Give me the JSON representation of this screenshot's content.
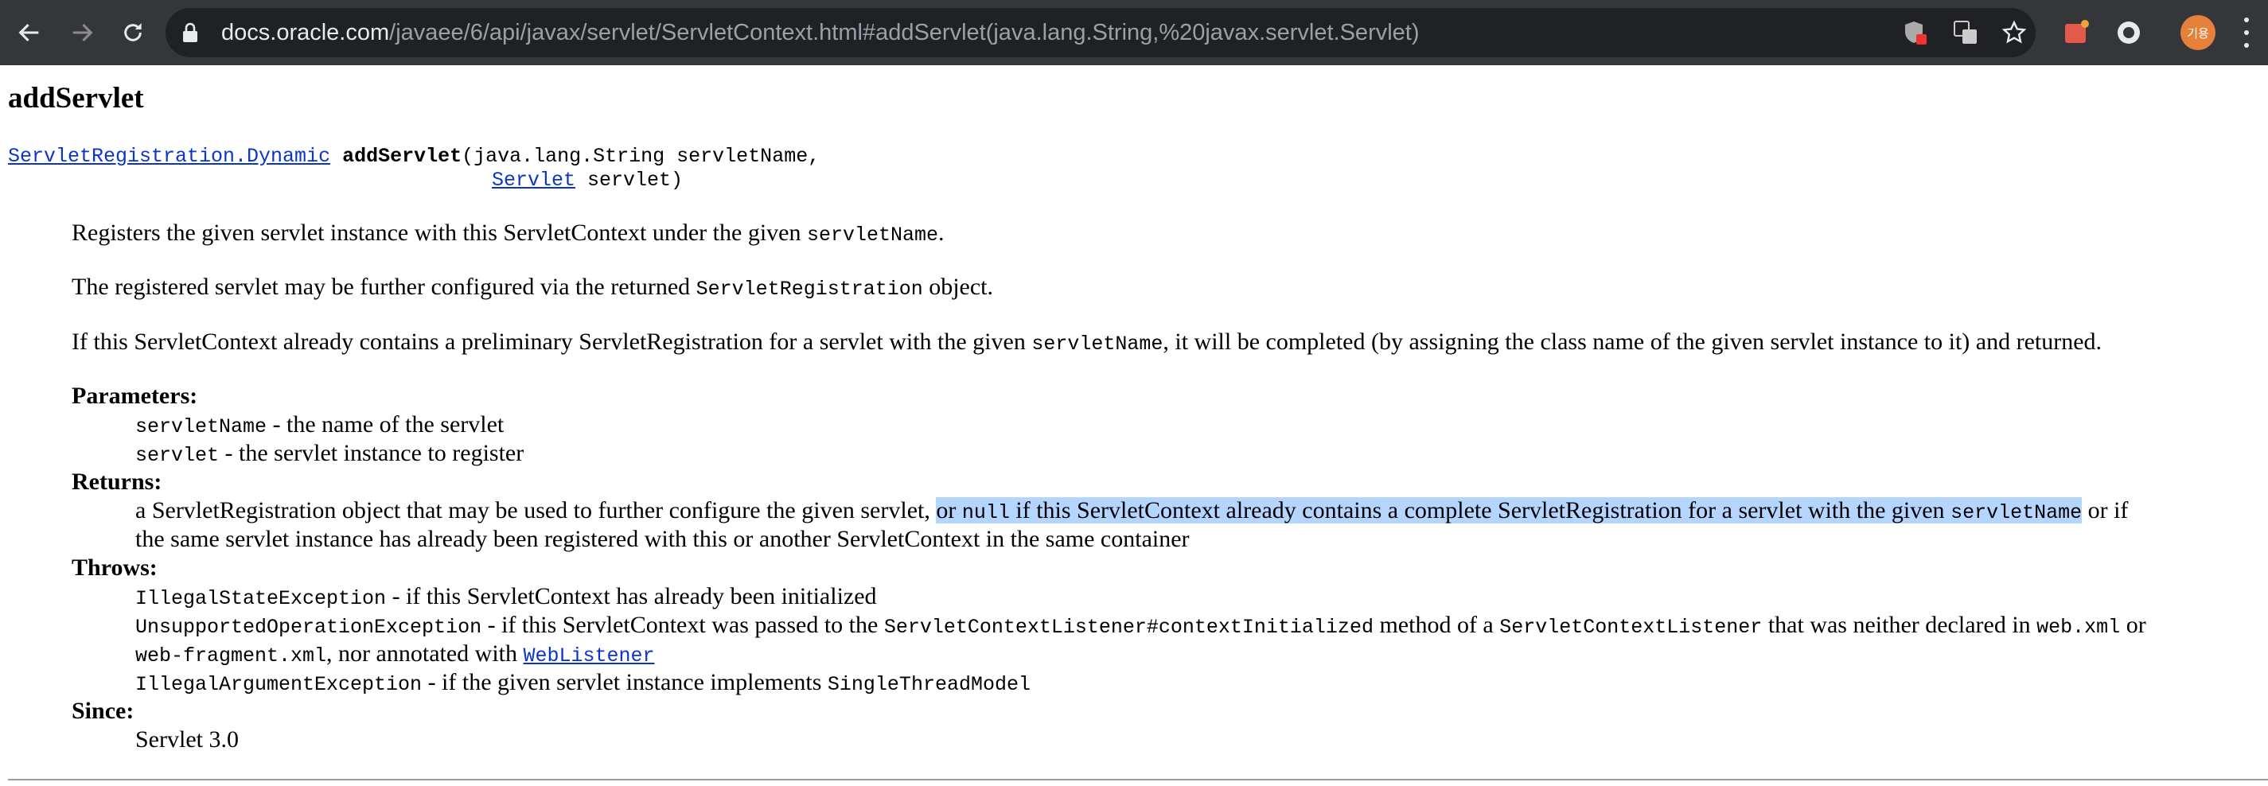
{
  "browser": {
    "url_host": "docs.oracle.com",
    "url_path": "/javaee/6/api/javax/servlet/ServletContext.html#addServlet(java.lang.String,%20javax.servlet.Servlet)",
    "avatar_text": "기용"
  },
  "doc": {
    "heading": "addServlet",
    "signature": {
      "return_type": "ServletRegistration.Dynamic",
      "method": "addServlet",
      "line1_rest": "(java.lang.String servletName,",
      "param2_type": "Servlet",
      "line2_rest": " servlet)"
    },
    "p1": {
      "text": "Registers the given servlet instance with this ServletContext under the given ",
      "code": "servletName",
      "tail": "."
    },
    "p2": {
      "text": "The registered servlet may be further configured via the returned ",
      "code": "ServletRegistration",
      "tail": " object."
    },
    "p3": {
      "text": "If this ServletContext already contains a preliminary ServletRegistration for a servlet with the given ",
      "code": "servletName",
      "tail": ", it will be completed (by assigning the class name of the given servlet instance to it) and returned."
    },
    "parameters_label": "Parameters:",
    "params": [
      {
        "name": "servletName",
        "desc": " - the name of the servlet"
      },
      {
        "name": "servlet",
        "desc": " - the servlet instance to register"
      }
    ],
    "returns_label": "Returns:",
    "returns": {
      "a": "a ServletRegistration object that may be used to further configure the given servlet, ",
      "hl1": "or ",
      "hl_code1": "null",
      "hl2": " if this ServletContext already contains a complete ServletRegistration for a servlet with the given ",
      "hl_code2": "servletName",
      "b": " or if",
      "line2": "the same servlet instance has already been registered with this or another ServletContext in the same container"
    },
    "throws_label": "Throws:",
    "throws": {
      "t1_code": "IllegalStateException",
      "t1_desc": " - if this ServletContext has already been initialized",
      "t2_code": "UnsupportedOperationException",
      "t2_a": " - if this ServletContext was passed to the ",
      "t2_code2": "ServletContextListener#contextInitialized",
      "t2_b": " method of a ",
      "t2_code3": "ServletContextListener",
      "t2_c": " that was neither declared in ",
      "t2_code4": "web.xml",
      "t2_d": " or",
      "t2_code5": "web-fragment.xml",
      "t2_e": ", nor annotated with ",
      "t2_link": "WebListener",
      "t3_code": "IllegalArgumentException",
      "t3_desc": " - if the given servlet instance implements ",
      "t3_code2": "SingleThreadModel"
    },
    "since_label": "Since:",
    "since": "Servlet 3.0"
  }
}
